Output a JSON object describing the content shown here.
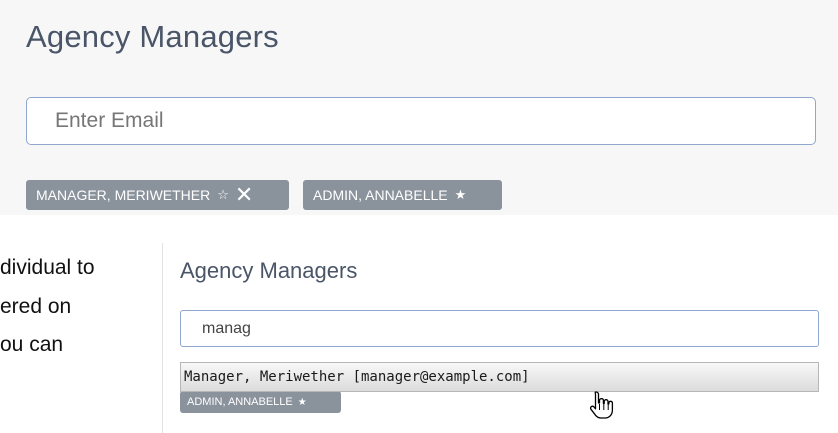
{
  "top_panel": {
    "title": "Agency Managers",
    "email_input": {
      "placeholder": "Enter Email",
      "value": ""
    },
    "chips": [
      {
        "label": "MANAGER, MERIWETHER",
        "star": "☆",
        "close": "✕"
      },
      {
        "label": "ADMIN, ANNABELLE",
        "star": "★"
      }
    ]
  },
  "side_text": {
    "line1": "dividual to",
    "line2": "ered on",
    "line3": "ou can"
  },
  "bottom_panel": {
    "title": "Agency Managers",
    "email_input": {
      "value": "manag"
    },
    "suggestion": "Manager, Meriwether [manager@example.com]",
    "chip": {
      "label": "ADMIN, ANNABELLE",
      "star": "★"
    }
  },
  "icons": {
    "cursor": "hand-pointer-icon"
  },
  "colors": {
    "chip_bg": "#8a929c",
    "input_border": "#8fa7cc",
    "title": "#4a5568"
  }
}
